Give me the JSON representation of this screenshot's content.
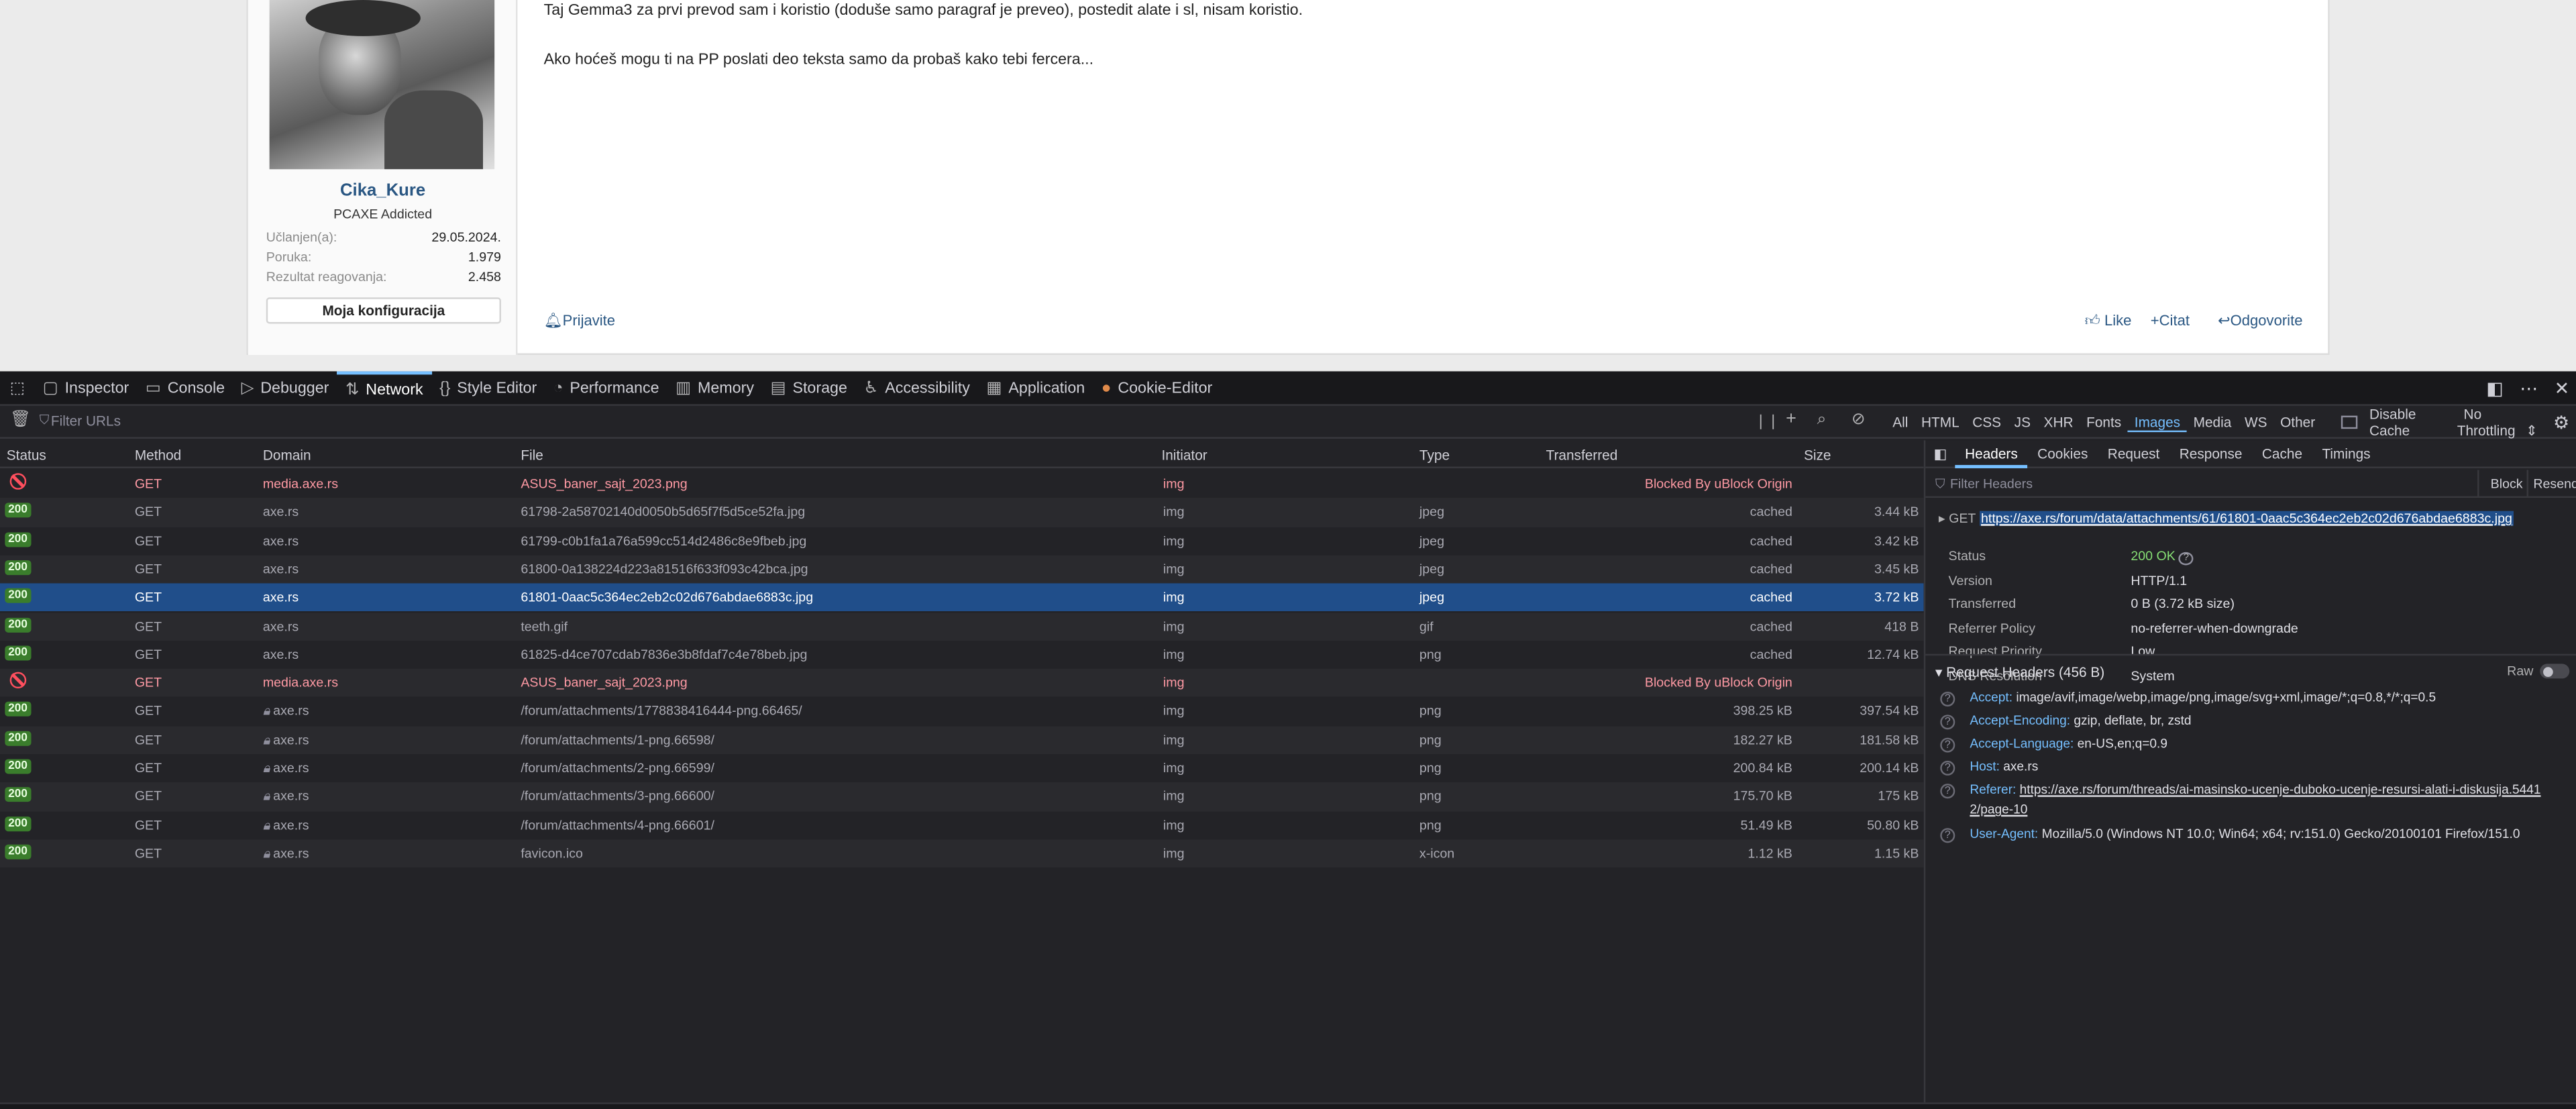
{
  "post": {
    "username": "Cika_Kure",
    "user_title": "PCAXE Addicted",
    "stats": [
      {
        "label": "Učlanjen(a):",
        "value": "29.05.2024."
      },
      {
        "label": "Poruka:",
        "value": "1.979"
      },
      {
        "label": "Rezultat reagovanja:",
        "value": "2.458"
      }
    ],
    "config_button": "Moja konfiguracija",
    "text1": "Taj Gemma3 za prvi prevod sam i koristio (doduše samo paragraf je preveo), postedit alate i sl, nisam koristio.",
    "text2": "Ako hoćeš mogu ti na PP poslati deo teksta samo da probaš kako tebi fercera...",
    "report": "Prijavite",
    "like": "Like",
    "quote": "Citat",
    "reply": "Odgovorite"
  },
  "devtools": {
    "tabs": [
      "Inspector",
      "Console",
      "Debugger",
      "Network",
      "Style Editor",
      "Performance",
      "Memory",
      "Storage",
      "Accessibility",
      "Application",
      "Cookie-Editor"
    ],
    "tab_icons": [
      "inspector-icon",
      "console-icon",
      "debugger-icon",
      "network-icon",
      "style-editor-icon",
      "performance-icon",
      "memory-icon",
      "storage-icon",
      "accessibility-icon",
      "application-icon",
      "cookie-icon"
    ],
    "filter_placeholder": "Filter URLs",
    "type_filters": [
      "All",
      "HTML",
      "CSS",
      "JS",
      "XHR",
      "Fonts",
      "Images",
      "Media",
      "WS",
      "Other"
    ],
    "selected_type": "Images",
    "disable_cache": "Disable Cache",
    "throttling": "No Throttling",
    "columns": [
      "Status",
      "Method",
      "Domain",
      "File",
      "Initiator",
      "Type",
      "Transferred",
      "Size"
    ],
    "requests": [
      {
        "status": "blocked",
        "method": "GET",
        "domain": "media.axe.rs",
        "file": "ASUS_baner_sajt_2023.png",
        "initiator": "img",
        "type": "",
        "transferred": "Blocked By uBlock Origin",
        "size": ""
      },
      {
        "status": "200",
        "method": "GET",
        "domain": "axe.rs",
        "file": "61798-2a58702140d0050b5d65f7f5d5ce52fa.jpg",
        "initiator": "img",
        "type": "jpeg",
        "transferred": "cached",
        "size": "3.44 kB"
      },
      {
        "status": "200",
        "method": "GET",
        "domain": "axe.rs",
        "file": "61799-c0b1fa1a76a599cc514d2486c8e9fbeb.jpg",
        "initiator": "img",
        "type": "jpeg",
        "transferred": "cached",
        "size": "3.42 kB"
      },
      {
        "status": "200",
        "method": "GET",
        "domain": "axe.rs",
        "file": "61800-0a138224d223a81516f633f093c42bca.jpg",
        "initiator": "img",
        "type": "jpeg",
        "transferred": "cached",
        "size": "3.45 kB"
      },
      {
        "status": "200",
        "method": "GET",
        "domain": "axe.rs",
        "file": "61801-0aac5c364ec2eb2c02d676abdae6883c.jpg",
        "initiator": "img",
        "type": "jpeg",
        "transferred": "cached",
        "size": "3.72 kB",
        "selected": true
      },
      {
        "status": "200",
        "method": "GET",
        "domain": "axe.rs",
        "file": "teeth.gif",
        "initiator": "img",
        "type": "gif",
        "transferred": "cached",
        "size": "418 B"
      },
      {
        "status": "200",
        "method": "GET",
        "domain": "axe.rs",
        "file": "61825-d4ce707cdab7836e3b8fdaf7c4e78beb.jpg",
        "initiator": "img",
        "type": "png",
        "transferred": "cached",
        "size": "12.74 kB"
      },
      {
        "status": "blocked",
        "method": "GET",
        "domain": "media.axe.rs",
        "file": "ASUS_baner_sajt_2023.png",
        "initiator": "img",
        "type": "",
        "transferred": "Blocked By uBlock Origin",
        "size": ""
      },
      {
        "status": "200",
        "method": "GET",
        "domain": "axe.rs",
        "file": "/forum/attachments/1778838416444-png.66465/",
        "initiator": "img",
        "type": "png",
        "transferred": "398.25 kB",
        "size": "397.54 kB",
        "lock": true
      },
      {
        "status": "200",
        "method": "GET",
        "domain": "axe.rs",
        "file": "/forum/attachments/1-png.66598/",
        "initiator": "img",
        "type": "png",
        "transferred": "182.27 kB",
        "size": "181.58 kB",
        "lock": true
      },
      {
        "status": "200",
        "method": "GET",
        "domain": "axe.rs",
        "file": "/forum/attachments/2-png.66599/",
        "initiator": "img",
        "type": "png",
        "transferred": "200.84 kB",
        "size": "200.14 kB",
        "lock": true
      },
      {
        "status": "200",
        "method": "GET",
        "domain": "axe.rs",
        "file": "/forum/attachments/3-png.66600/",
        "initiator": "img",
        "type": "png",
        "transferred": "175.70 kB",
        "size": "175 kB",
        "lock": true
      },
      {
        "status": "200",
        "method": "GET",
        "domain": "axe.rs",
        "file": "/forum/attachments/4-png.66601/",
        "initiator": "img",
        "type": "png",
        "transferred": "51.49 kB",
        "size": "50.80 kB",
        "lock": true
      },
      {
        "status": "200",
        "method": "GET",
        "domain": "axe.rs",
        "file": "favicon.ico",
        "initiator": "img",
        "type": "x-icon",
        "transferred": "1.12 kB",
        "size": "1.15 kB",
        "lock": true
      }
    ],
    "side_tabs": [
      "Headers",
      "Cookies",
      "Request",
      "Response",
      "Cache",
      "Timings"
    ],
    "filter_headers": "Filter Headers",
    "block": "Block",
    "resend": "Resend",
    "req_method": "GET",
    "req_url": "https://axe.rs/forum/data/attachments/61/61801-0aac5c364ec2eb2c02d676abdae6883c.jpg",
    "summary": [
      {
        "k": "Status",
        "v": "200 OK"
      },
      {
        "k": "Version",
        "v": "HTTP/1.1"
      },
      {
        "k": "Transferred",
        "v": "0 B (3.72 kB size)"
      },
      {
        "k": "Referrer Policy",
        "v": "no-referrer-when-downgrade"
      },
      {
        "k": "Request Priority",
        "v": "Low"
      },
      {
        "k": "DNS Resolution",
        "v": "System"
      }
    ],
    "req_headers_title": "Request Headers (456 B)",
    "raw": "Raw",
    "headers": [
      {
        "k": "Accept:",
        "v": "image/avif,image/webp,image/png,image/svg+xml,image/*;q=0.8,*/*;q=0.5"
      },
      {
        "k": "Accept-Encoding:",
        "v": "gzip, deflate, br, zstd"
      },
      {
        "k": "Accept-Language:",
        "v": "en-US,en;q=0.9"
      },
      {
        "k": "Host:",
        "v": "axe.rs"
      },
      {
        "k": "Referer:",
        "v": "https://axe.rs/forum/threads/ai-masinsko-ucenje-duboko-ucenje-resursi-alati-i-diskusija.5441",
        "v2": "2/page-10"
      },
      {
        "k": "User-Agent:",
        "v": "Mozilla/5.0 (Windows NT 10.0; Win64; x64; rv:151.0) Gecko/20100101 Firefox/151.0"
      }
    ]
  }
}
